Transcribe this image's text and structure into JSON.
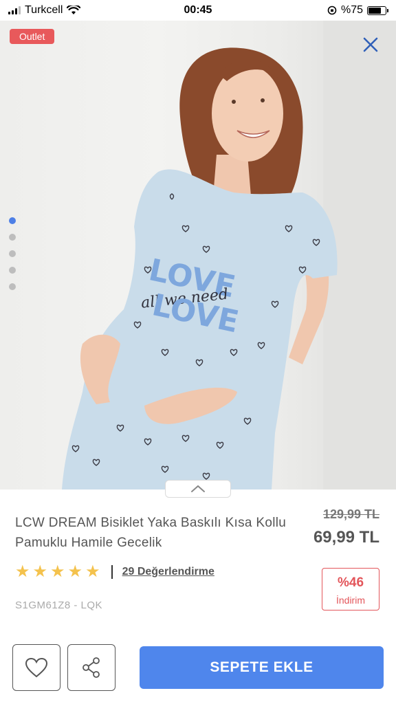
{
  "status_bar": {
    "carrier": "Turkcell",
    "time": "00:45",
    "battery_label": "%75"
  },
  "product_image": {
    "badge": "Outlet",
    "close_icon": "close-icon",
    "carousel": {
      "count": 5,
      "active_index": 0
    },
    "print_text_top": "LOVE",
    "print_text_script": "all we need",
    "print_text_bottom": "LOVE"
  },
  "product": {
    "title": "LCW DREAM Bisiklet Yaka Baskılı Kısa Kollu Pamuklu Hamile Gecelik",
    "old_price": "129,99 TL",
    "new_price": "69,99 TL",
    "rating_stars": 5,
    "reviews_link": "29 Değerlendirme",
    "discount_percent": "%46",
    "discount_label": "İndirim",
    "sku": "S1GM61Z8 - LQK"
  },
  "actions": {
    "favorite_icon": "heart-icon",
    "share_icon": "share-icon",
    "add_to_cart": "SEPETE EKLE"
  },
  "colors": {
    "accent": "#4f86ec",
    "sale": "#e3555a",
    "outlet_badge": "#e8595b",
    "star": "#f4c24d",
    "gown": "#c9dcea"
  }
}
